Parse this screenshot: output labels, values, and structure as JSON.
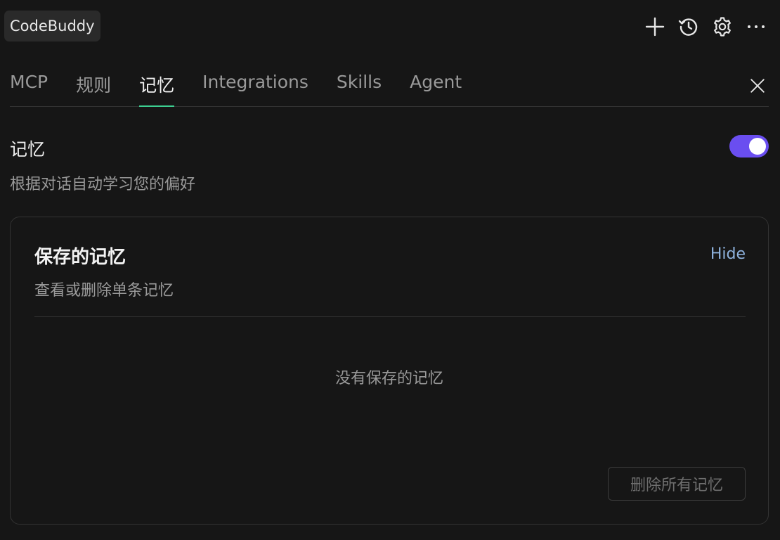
{
  "header": {
    "app_name": "CodeBuddy",
    "actions": [
      {
        "name": "new-chat",
        "icon": "plus-icon"
      },
      {
        "name": "history",
        "icon": "history-icon"
      },
      {
        "name": "settings",
        "icon": "gear-icon"
      },
      {
        "name": "more",
        "icon": "more-icon"
      }
    ]
  },
  "tabs": [
    {
      "label": "MCP",
      "active": false
    },
    {
      "label": "规则",
      "active": false
    },
    {
      "label": "记忆",
      "active": true
    },
    {
      "label": "Integrations",
      "active": false
    },
    {
      "label": "Skills",
      "active": false
    },
    {
      "label": "Agent",
      "active": false
    }
  ],
  "memory": {
    "title": "记忆",
    "description": "根据对话自动学习您的偏好",
    "enabled": true
  },
  "saved": {
    "title": "保存的记忆",
    "subtitle": "查看或删除单条记忆",
    "hide_label": "Hide",
    "empty_text": "没有保存的记忆",
    "delete_all_label": "删除所有记忆"
  },
  "colors": {
    "background": "#161616",
    "accent_tab": "#3ccf91",
    "toggle_on": "#6a4ef0",
    "link": "#8fb3de"
  }
}
